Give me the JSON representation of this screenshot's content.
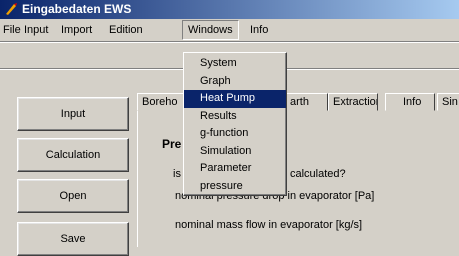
{
  "window": {
    "title": "Eingabedaten EWS"
  },
  "menubar": {
    "items": [
      "File",
      "Input",
      "Import",
      "Edition",
      "Windows",
      "Info"
    ]
  },
  "sidebar": {
    "buttons": [
      "Input",
      "Calculation",
      "Open",
      "Save"
    ]
  },
  "tabs": [
    "Boreho",
    "arth",
    "Extraction",
    "Info",
    "Sin"
  ],
  "panel": {
    "heading": "Pre",
    "line1_left": "is",
    "line1_right": "calculated?",
    "line2": "nominal pressure drop in evaporator [Pa]",
    "line3": "nominal mass flow in evaporator [kg/s]"
  },
  "windows_menu": {
    "items": [
      "System",
      "Graph",
      "Heat Pump",
      "Results",
      "g-function",
      "Simulation",
      "Parameter",
      "pressure"
    ],
    "highlighted": "Heat Pump"
  },
  "colors": {
    "title_bar": "#0a246a",
    "highlight": "#0a246a",
    "face": "#d4d0c8"
  }
}
